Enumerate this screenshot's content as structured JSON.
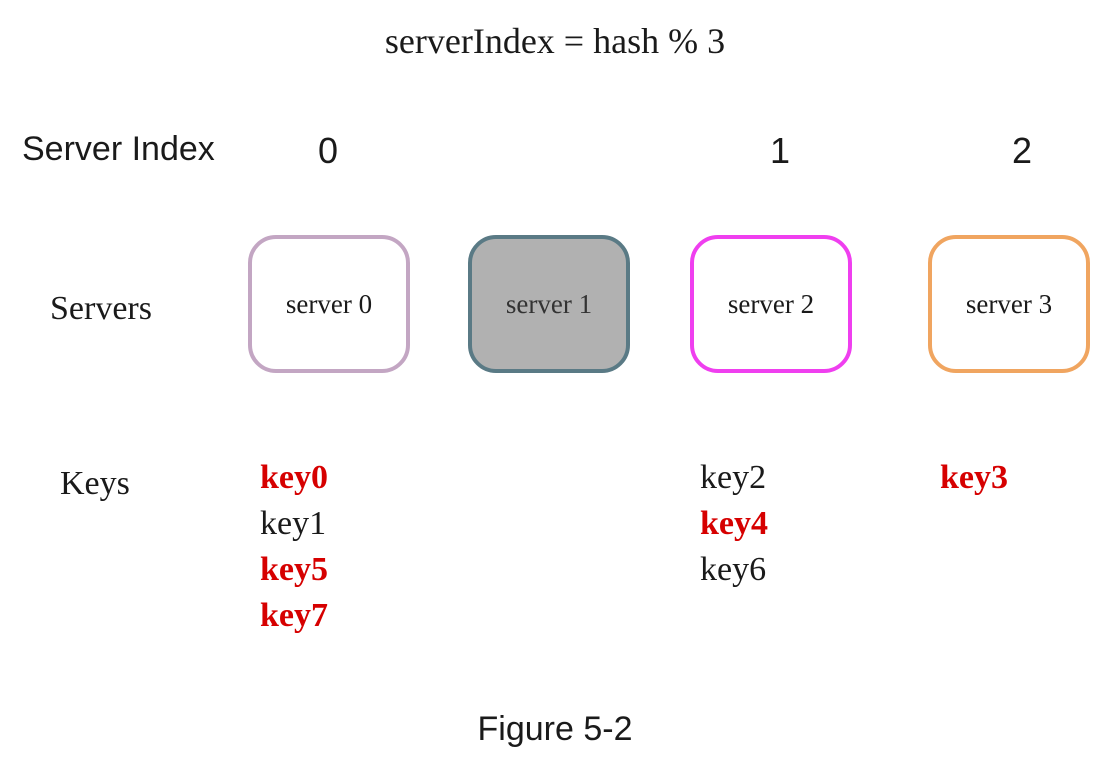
{
  "formula": "serverIndex = hash % 3",
  "labels": {
    "server_index": "Server Index",
    "servers": "Servers",
    "keys": "Keys"
  },
  "indices": [
    "0",
    "1",
    "2"
  ],
  "servers": [
    {
      "label": "server 0",
      "active": true
    },
    {
      "label": "server 1",
      "active": false
    },
    {
      "label": "server 2",
      "active": true
    },
    {
      "label": "server 3",
      "active": true
    }
  ],
  "key_columns": {
    "col0": [
      {
        "text": "key0",
        "moved": true
      },
      {
        "text": "key1",
        "moved": false
      },
      {
        "text": "key5",
        "moved": true
      },
      {
        "text": "key7",
        "moved": true
      }
    ],
    "col2": [
      {
        "text": "key2",
        "moved": false
      },
      {
        "text": "key4",
        "moved": true
      },
      {
        "text": "key6",
        "moved": false
      }
    ],
    "col3": [
      {
        "text": "key3",
        "moved": true
      }
    ]
  },
  "caption": "Figure 5-2"
}
